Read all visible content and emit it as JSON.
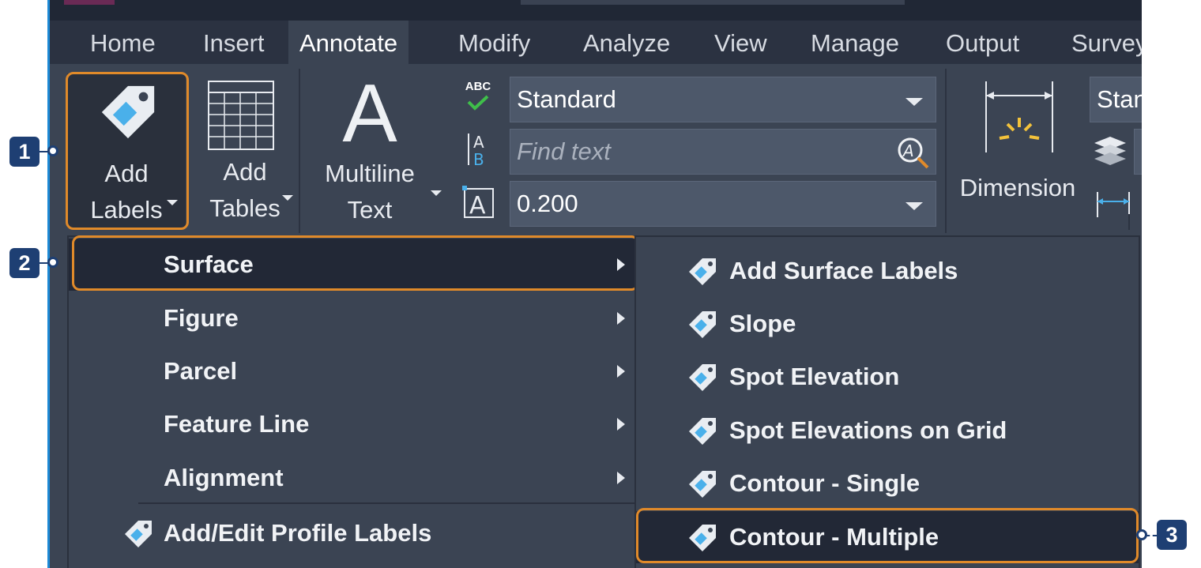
{
  "tabs": [
    "Home",
    "Insert",
    "Annotate",
    "Modify",
    "Analyze",
    "View",
    "Manage",
    "Output",
    "Survey"
  ],
  "ribbon": {
    "add_labels": [
      "Add",
      "Labels"
    ],
    "add_tables": [
      "Add",
      "Tables"
    ],
    "multiline_text": [
      "Multiline",
      "Text"
    ],
    "multiline_glyph": "A",
    "spell_icon_text": "ABC",
    "text_style_value": "Standard",
    "find_text_placeholder": "Find text",
    "text_height_value": "0.200",
    "dimension_label": "Dimension",
    "dim_style_value": "Stan"
  },
  "labels_menu": {
    "items": [
      "Surface",
      "Figure",
      "Parcel",
      "Feature Line",
      "Alignment"
    ],
    "profile_item": "Add/Edit Profile Labels"
  },
  "surface_submenu": {
    "items": [
      "Add Surface Labels",
      "Slope",
      "Spot Elevation",
      "Spot Elevations on Grid",
      "Contour - Single",
      "Contour - Multiple"
    ]
  },
  "callouts": [
    "1",
    "2",
    "3"
  ],
  "colors": {
    "highlight": "#e08a2a",
    "callout": "#1e3f73",
    "panel": "#3b4453",
    "tab_bar": "#2b3241"
  }
}
